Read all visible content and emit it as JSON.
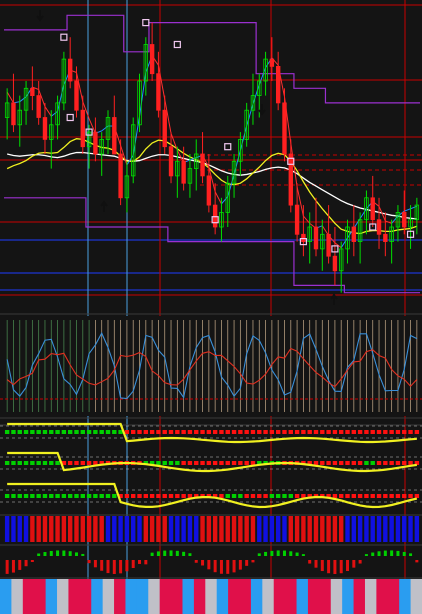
{
  "colors": {
    "background": "#141414",
    "grid_red": "#c80000",
    "grid_blue": "#1e3cff",
    "bull": "#00e000",
    "bear": "#ff2020",
    "ma_white": "#ffffff",
    "ma_yellow": "#f0f020",
    "ma_red": "#ff3030",
    "ma_blue": "#1e90ff",
    "envelope": "#9b30d0",
    "cursor_blue": "#4aa0e0",
    "arrow": "#000000",
    "osc_blue": "#3a8fd8",
    "osc_red": "#e03020",
    "osc_bar": "#e8c8a0",
    "dot_green": "#00d000",
    "dot_red": "#ff1010",
    "hist_blue": "#1010e0",
    "hist_red": "#e01010",
    "strip_red": "#e0104a",
    "strip_blue": "#2a9df0",
    "strip_gray": "#c0c0c8"
  },
  "icons": [
    "down-arrow-icon",
    "up-arrow-icon",
    "marker-square-icon"
  ],
  "chart_data": {
    "type": "candlestick",
    "candles_note": "",
    "candles": [
      [
        3,
        7,
        0,
        5
      ],
      [
        5,
        9,
        1,
        2
      ],
      [
        2,
        6,
        -1,
        4
      ],
      [
        4,
        8,
        2,
        7
      ],
      [
        7,
        10,
        4,
        6
      ],
      [
        6,
        8,
        2,
        3
      ],
      [
        3,
        5,
        -2,
        0
      ],
      [
        0,
        4,
        -4,
        2
      ],
      [
        2,
        6,
        0,
        5
      ],
      [
        5,
        12,
        4,
        11
      ],
      [
        11,
        14,
        7,
        8
      ],
      [
        8,
        10,
        3,
        4
      ],
      [
        4,
        6,
        -2,
        -1
      ],
      [
        -1,
        2,
        -4,
        1
      ],
      [
        1,
        3,
        -3,
        -2
      ],
      [
        -2,
        1,
        -5,
        0
      ],
      [
        0,
        4,
        -2,
        3
      ],
      [
        3,
        6,
        -1,
        -2
      ],
      [
        -2,
        0,
        -9,
        -8
      ],
      [
        -8,
        -3,
        -10,
        -5
      ],
      [
        -5,
        3,
        -6,
        2
      ],
      [
        2,
        9,
        1,
        8
      ],
      [
        8,
        14,
        6,
        13
      ],
      [
        13,
        16,
        8,
        9
      ],
      [
        9,
        12,
        3,
        4
      ],
      [
        4,
        6,
        -2,
        -1
      ],
      [
        -1,
        1,
        -6,
        -5
      ],
      [
        -5,
        -1,
        -8,
        -3
      ],
      [
        -3,
        -1,
        -7,
        -6
      ],
      [
        -6,
        -2,
        -8,
        -4
      ],
      [
        -4,
        0,
        -7,
        -2
      ],
      [
        -2,
        1,
        -6,
        -5
      ],
      [
        -5,
        -2,
        -10,
        -9
      ],
      [
        -9,
        -6,
        -13,
        -12
      ],
      [
        -12,
        -8,
        -14,
        -10
      ],
      [
        -10,
        -5,
        -12,
        -6
      ],
      [
        -6,
        -2,
        -8,
        -3
      ],
      [
        -3,
        1,
        -5,
        0
      ],
      [
        0,
        5,
        -1,
        4
      ],
      [
        4,
        9,
        2,
        6
      ],
      [
        6,
        9,
        3,
        8
      ],
      [
        8,
        12,
        6,
        11
      ],
      [
        11,
        14,
        8,
        10
      ],
      [
        10,
        12,
        4,
        5
      ],
      [
        5,
        7,
        -3,
        -2
      ],
      [
        -2,
        0,
        -10,
        -9
      ],
      [
        -9,
        -6,
        -14,
        -13
      ],
      [
        -13,
        -9,
        -16,
        -14
      ],
      [
        -14,
        -10,
        -17,
        -12
      ],
      [
        -12,
        -8,
        -16,
        -15
      ],
      [
        -15,
        -11,
        -18,
        -13
      ],
      [
        -13,
        -9,
        -17,
        -16
      ],
      [
        -16,
        -12,
        -20,
        -18
      ],
      [
        -18,
        -14,
        -21,
        -15
      ],
      [
        -15,
        -11,
        -17,
        -12
      ],
      [
        -12,
        -9,
        -16,
        -14
      ],
      [
        -14,
        -10,
        -17,
        -11
      ],
      [
        -11,
        -7,
        -13,
        -8
      ],
      [
        -8,
        -5,
        -12,
        -11
      ],
      [
        -11,
        -8,
        -15,
        -13
      ],
      [
        -13,
        -10,
        -16,
        -14
      ],
      [
        -14,
        -11,
        -17,
        -12
      ],
      [
        -12,
        -9,
        -14,
        -10
      ],
      [
        -10,
        -7,
        -13,
        -12
      ],
      [
        -12,
        -9,
        -15,
        -11
      ],
      [
        -11,
        -8,
        -13,
        -9
      ]
    ],
    "ma_white": [
      -2,
      -2.2,
      -2.3,
      -2.2,
      -2.1,
      -2.1,
      -2.2,
      -2.4,
      -2.5,
      -2.3,
      -2,
      -1.8,
      -1.8,
      -1.9,
      -2,
      -2.1,
      -2.2,
      -2.3,
      -2.6,
      -2.9,
      -3,
      -2.9,
      -2.6,
      -2.3,
      -2.1,
      -2.1,
      -2.2,
      -2.4,
      -2.6,
      -2.8,
      -3,
      -3.2,
      -3.5,
      -3.9,
      -4.3,
      -4.6,
      -4.8,
      -4.9,
      -4.8,
      -4.6,
      -4.4,
      -4.1,
      -3.9,
      -3.8,
      -3.9,
      -4.2,
      -4.7,
      -5.3,
      -5.9,
      -6.4,
      -6.9,
      -7.4,
      -7.9,
      -8.4,
      -8.8,
      -9.1,
      -9.4,
      -9.6,
      -9.8,
      -10,
      -10.2,
      -10.4,
      -10.5,
      -10.7,
      -10.8,
      -10.9
    ],
    "ma_yellow": [
      -4,
      -3.6,
      -3.3,
      -2.9,
      -2.3,
      -1.9,
      -1.8,
      -1.9,
      -1.8,
      -1.1,
      -0.3,
      0.1,
      0,
      -0.4,
      -0.8,
      -1.1,
      -1.2,
      -1.5,
      -2.3,
      -3,
      -3,
      -2.4,
      -1.3,
      -0.5,
      -0.1,
      -0.2,
      -0.7,
      -1.3,
      -1.9,
      -2.4,
      -2.8,
      -3.2,
      -3.9,
      -4.8,
      -5.6,
      -6.1,
      -6.2,
      -6,
      -5.4,
      -4.6,
      -3.8,
      -2.9,
      -2.2,
      -1.9,
      -2.1,
      -3,
      -4.3,
      -5.8,
      -7.2,
      -8.4,
      -9.5,
      -10.5,
      -11.5,
      -12.3,
      -12.6,
      -12.8,
      -12.9,
      -12.6,
      -12.5,
      -12.5,
      -12.6,
      -12.6,
      -12.4,
      -12.3,
      -12.2,
      -11.9
    ],
    "envelope_upper": [
      15,
      15,
      15,
      15,
      15,
      15,
      15,
      15,
      15,
      15,
      17,
      17,
      17,
      17,
      17,
      17,
      17,
      17,
      17,
      12,
      12,
      12,
      12,
      16,
      16,
      16,
      16,
      16,
      16,
      16,
      16,
      16,
      16,
      16,
      16,
      16,
      16,
      16,
      16,
      16,
      9,
      9,
      9,
      9,
      9,
      9,
      7,
      7,
      7,
      7,
      7,
      5,
      5,
      5,
      5,
      5,
      5,
      5,
      5,
      5,
      5,
      5,
      5,
      5,
      5,
      5
    ],
    "envelope_lower": [
      -8,
      -8,
      -8,
      -8,
      -8,
      -8,
      -8,
      -8,
      -8,
      -8,
      -8,
      -8,
      -8,
      -12,
      -12,
      -12,
      -12,
      -12,
      -12,
      -12,
      -12,
      -12,
      -12,
      -12,
      -12,
      -12,
      -14,
      -14,
      -14,
      -14,
      -14,
      -14,
      -14,
      -14,
      -14,
      -14,
      -14,
      -14,
      -14,
      -14,
      -14,
      -14,
      -14,
      -14,
      -14,
      -14,
      -20,
      -20,
      -20,
      -20,
      -20,
      -20,
      -20,
      -20,
      -21,
      -21,
      -21,
      -21,
      -21,
      -21,
      -21,
      -21,
      -21,
      -21,
      -21,
      -21
    ]
  }
}
